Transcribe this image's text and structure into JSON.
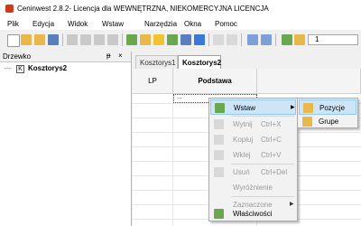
{
  "window": {
    "title": "Ceninwest 2.8.2- Licencja dla WEWNĘTRZNA, NIEKOMERCYJNA LICENCJA"
  },
  "menubar": {
    "items": [
      "Plik",
      "Edycja",
      "Widok",
      "Wstaw",
      "Narzędzia",
      "Okna",
      "Pomoc"
    ]
  },
  "toolbar": {
    "input_value": "1"
  },
  "tree_panel": {
    "title": "Drzewko",
    "pin_glyph": "ᵽ",
    "close_glyph": "×",
    "root_label": "Kosztorys2",
    "root_icon_letter": "K",
    "dots": "·····"
  },
  "tabs": [
    {
      "label": "Kosztorys1"
    },
    {
      "label": "Kosztorys2"
    }
  ],
  "grid": {
    "headers": [
      "LP",
      "Podstawa"
    ],
    "cell_value": "..."
  },
  "context_menu": {
    "items": [
      {
        "label": "Wstaw",
        "shortcut": "",
        "enabled": true,
        "submenu": true,
        "highlighted": true
      },
      {
        "label": "Wytnij",
        "shortcut": "Ctrl+X",
        "enabled": false
      },
      {
        "label": "Kopiuj",
        "shortcut": "Ctrl+C",
        "enabled": false
      },
      {
        "label": "Wklej",
        "shortcut": "Ctrl+V",
        "enabled": false
      },
      {
        "label": "Usuń",
        "shortcut": "Ctrl+Del",
        "enabled": false
      },
      {
        "label": "Wyróżnienie",
        "shortcut": "",
        "enabled": false
      },
      {
        "label": "Zaznaczone",
        "shortcut": "",
        "enabled": false,
        "submenu": true
      },
      {
        "label": "Właściwości",
        "shortcut": "",
        "enabled": true
      }
    ],
    "submenu_arrow": "▶"
  },
  "submenu": {
    "items": [
      {
        "label": "Pozycje",
        "highlighted": true
      },
      {
        "label": "Grupe",
        "highlighted": false
      }
    ]
  },
  "colors": {
    "highlight": "#cde5f7",
    "highlight_border": "#90c8f6",
    "disabled": "#9a9a9a",
    "app_icon": "#d03a1a"
  }
}
